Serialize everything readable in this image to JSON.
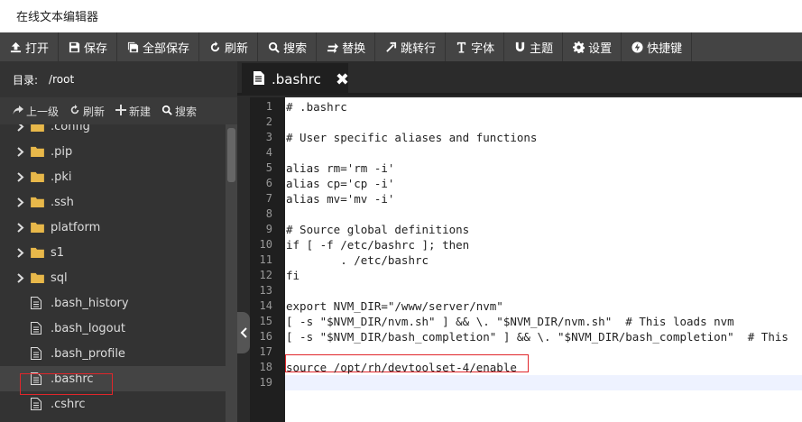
{
  "app": {
    "title": "在线文本编辑器"
  },
  "toolbar": {
    "buttons": [
      {
        "label": "打开",
        "icon": "upload-icon"
      },
      {
        "label": "保存",
        "icon": "save-icon"
      },
      {
        "label": "全部保存",
        "icon": "save-all-icon"
      },
      {
        "label": "刷新",
        "icon": "refresh-icon"
      },
      {
        "label": "搜索",
        "icon": "search-icon"
      },
      {
        "label": "替换",
        "icon": "replace-icon"
      },
      {
        "label": "跳转行",
        "icon": "jump-icon"
      },
      {
        "label": "字体",
        "icon": "font-icon"
      },
      {
        "label": "主题",
        "icon": "magnet-icon"
      },
      {
        "label": "设置",
        "icon": "gear-icon"
      },
      {
        "label": "快捷键",
        "icon": "lightning-icon"
      }
    ]
  },
  "sidebar": {
    "dir_label": "目录:",
    "dir_path": "/root",
    "tools": [
      {
        "label": "上一级",
        "icon": "share-icon"
      },
      {
        "label": "刷新",
        "icon": "refresh-icon"
      },
      {
        "label": "新建",
        "icon": "plus-icon"
      },
      {
        "label": "搜索",
        "icon": "search-icon"
      }
    ],
    "tree": [
      {
        "name": ".config",
        "type": "folder"
      },
      {
        "name": ".pip",
        "type": "folder"
      },
      {
        "name": ".pki",
        "type": "folder"
      },
      {
        "name": ".ssh",
        "type": "folder"
      },
      {
        "name": "platform",
        "type": "folder"
      },
      {
        "name": "s1",
        "type": "folder"
      },
      {
        "name": "sql",
        "type": "folder"
      },
      {
        "name": ".bash_history",
        "type": "file"
      },
      {
        "name": ".bash_logout",
        "type": "file"
      },
      {
        "name": ".bash_profile",
        "type": "file"
      },
      {
        "name": ".bashrc",
        "type": "file",
        "selected": true
      },
      {
        "name": ".cshrc",
        "type": "file"
      }
    ]
  },
  "editor": {
    "tab_label": ".bashrc",
    "close_label": "✖",
    "lines": [
      "# .bashrc",
      "",
      "# User specific aliases and functions",
      "",
      "alias rm='rm -i'",
      "alias cp='cp -i'",
      "alias mv='mv -i'",
      "",
      "# Source global definitions",
      "if [ -f /etc/bashrc ]; then",
      "        . /etc/bashrc",
      "fi",
      "",
      "export NVM_DIR=\"/www/server/nvm\"",
      "[ -s \"$NVM_DIR/nvm.sh\" ] && \\. \"$NVM_DIR/nvm.sh\"  # This loads nvm",
      "[ -s \"$NVM_DIR/bash_completion\" ] && \\. \"$NVM_DIR/bash_completion\"  # This",
      "",
      "source /opt/rh/devtoolset-4/enable",
      ""
    ],
    "line_numbers": [
      "1",
      "2",
      "3",
      "4",
      "5",
      "6",
      "7",
      "8",
      "9",
      "10",
      "11",
      "12",
      "13",
      "14",
      "15",
      "16",
      "17",
      "18",
      "19"
    ]
  },
  "colors": {
    "toolbar_bg": "#444444",
    "sidebar_bg": "#333333",
    "highlight": "#e0262b",
    "folder": "#e8b84a"
  }
}
